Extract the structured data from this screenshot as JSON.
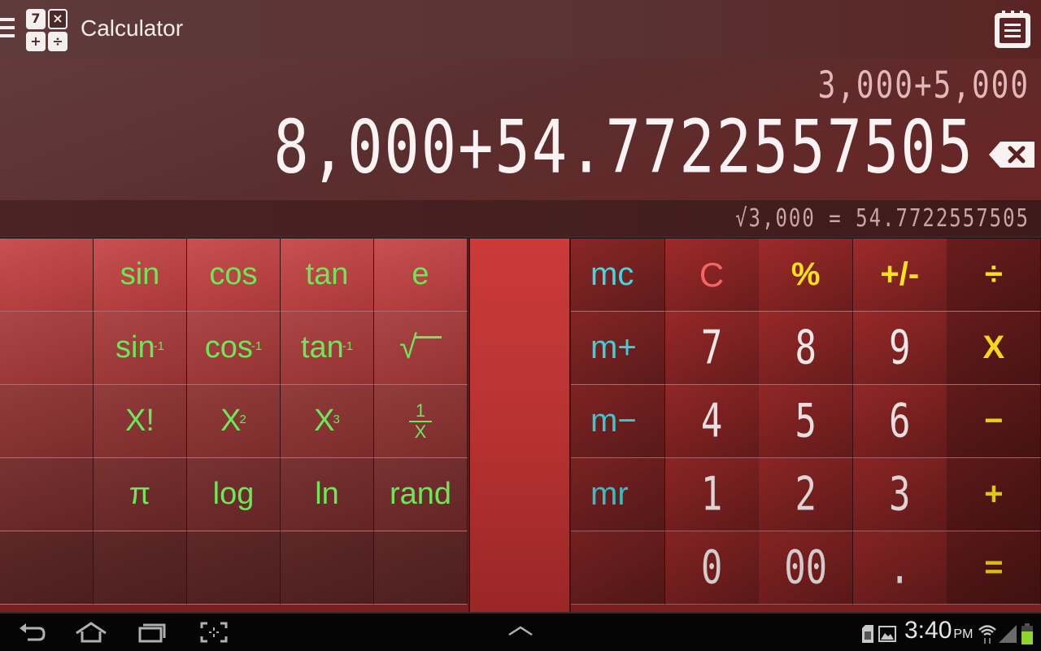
{
  "app": {
    "title": "Calculator",
    "logo_glyphs": [
      "7",
      "×",
      "+",
      "÷"
    ]
  },
  "display": {
    "previous_expression": "3,000+5,000",
    "current_expression": "8,000+54.7722557505",
    "result_line": "√3,000 = 54.7722557505"
  },
  "scientific_keys": [
    [
      {
        "label": "",
        "name": "blank"
      },
      {
        "label": "sin",
        "name": "sin"
      },
      {
        "label": "cos",
        "name": "cos"
      },
      {
        "label": "tan",
        "name": "tan"
      },
      {
        "label": "e",
        "name": "e"
      }
    ],
    [
      {
        "label": "",
        "name": "blank"
      },
      {
        "label": "sin",
        "sup": "-1",
        "name": "asin"
      },
      {
        "label": "cos",
        "sup": "-1",
        "name": "acos"
      },
      {
        "label": "tan",
        "sup": "-1",
        "name": "atan"
      },
      {
        "label": "√",
        "name": "sqrt"
      }
    ],
    [
      {
        "label": "",
        "name": "blank"
      },
      {
        "label": "X!",
        "name": "factorial"
      },
      {
        "label": "X",
        "sup": "2",
        "name": "square"
      },
      {
        "label": "X",
        "sup": "3",
        "name": "cube"
      },
      {
        "label": "1/x",
        "num": "1",
        "den": "X",
        "name": "reciprocal"
      }
    ],
    [
      {
        "label": "",
        "name": "blank"
      },
      {
        "label": "π",
        "name": "pi"
      },
      {
        "label": "log",
        "name": "log"
      },
      {
        "label": "ln",
        "name": "ln"
      },
      {
        "label": "rand",
        "name": "rand"
      }
    ],
    [
      {
        "label": "",
        "name": "blank"
      },
      {
        "label": "",
        "name": "blank"
      },
      {
        "label": "",
        "name": "blank"
      },
      {
        "label": "",
        "name": "blank"
      },
      {
        "label": "",
        "name": "blank"
      }
    ]
  ],
  "basic_keys": [
    [
      {
        "label": "mc",
        "type": "mem",
        "name": "memory-clear"
      },
      {
        "label": "C",
        "type": "clr",
        "name": "clear"
      },
      {
        "label": "%",
        "type": "op",
        "name": "percent"
      },
      {
        "label": "+/-",
        "type": "op",
        "name": "plus-minus"
      },
      {
        "label": "÷",
        "type": "op",
        "name": "divide"
      }
    ],
    [
      {
        "label": "m+",
        "type": "mem",
        "name": "memory-add"
      },
      {
        "label": "7",
        "type": "dig",
        "name": "digit-7"
      },
      {
        "label": "8",
        "type": "dig",
        "name": "digit-8"
      },
      {
        "label": "9",
        "type": "dig",
        "name": "digit-9"
      },
      {
        "label": "X",
        "type": "op",
        "name": "multiply"
      }
    ],
    [
      {
        "label": "m−",
        "type": "mem",
        "name": "memory-subtract"
      },
      {
        "label": "4",
        "type": "dig",
        "name": "digit-4"
      },
      {
        "label": "5",
        "type": "dig",
        "name": "digit-5"
      },
      {
        "label": "6",
        "type": "dig",
        "name": "digit-6"
      },
      {
        "label": "−",
        "type": "op",
        "name": "subtract"
      }
    ],
    [
      {
        "label": "mr",
        "type": "mem",
        "name": "memory-recall"
      },
      {
        "label": "1",
        "type": "dig",
        "name": "digit-1"
      },
      {
        "label": "2",
        "type": "dig",
        "name": "digit-2"
      },
      {
        "label": "3",
        "type": "dig",
        "name": "digit-3"
      },
      {
        "label": "+",
        "type": "op",
        "name": "add"
      }
    ],
    [
      {
        "label": "",
        "type": "mem",
        "name": "blank"
      },
      {
        "label": "0",
        "type": "dig",
        "name": "digit-0"
      },
      {
        "label": "00",
        "type": "dig",
        "name": "double-zero"
      },
      {
        "label": ".",
        "type": "dig",
        "name": "decimal-point"
      },
      {
        "label": "=",
        "type": "op",
        "name": "equals"
      }
    ]
  ],
  "statusbar": {
    "time": "3:40",
    "ampm": "PM"
  },
  "colors": {
    "scientific_text": "#6be85a",
    "memory_text": "#3fd8e0",
    "clear_text": "#f26565",
    "operator_text": "#ffe21a",
    "digit_text": "#fbf1f1",
    "battery": "#8fd42a"
  }
}
